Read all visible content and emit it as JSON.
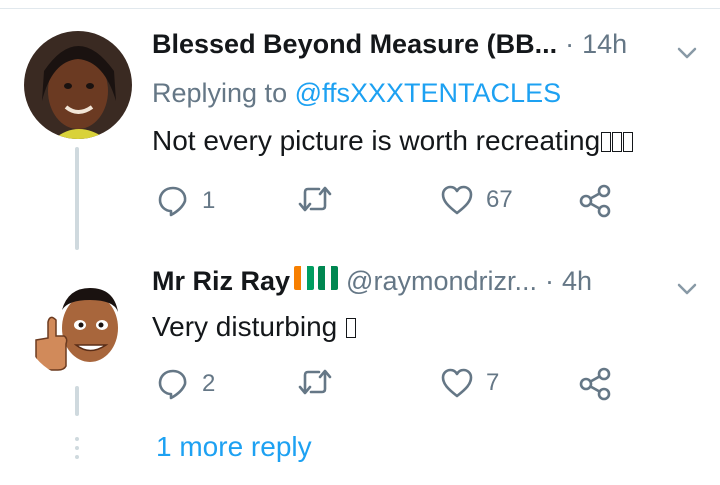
{
  "tweets": [
    {
      "name": "Blessed Beyond Measure (BB...",
      "handle": "",
      "time": "14h",
      "replying_prefix": "Replying to",
      "replying_to": "@ffsXXXTENTACLES",
      "text": "Not every picture is worth recreating",
      "emoji_count": 3,
      "actions": {
        "reply": "1",
        "retweet": "",
        "like": "67"
      }
    },
    {
      "name": "Mr Riz Ray",
      "handle": "@raymondrizr...",
      "time": "4h",
      "text": "Very disturbing",
      "emoji_count": 1,
      "flags": [
        "cote-divoire-flag",
        "nigeria-flag"
      ],
      "actions": {
        "reply": "2",
        "retweet": "",
        "like": "7"
      }
    }
  ],
  "more_replies": "1 more reply",
  "colors": {
    "link": "#1da1f2",
    "muted": "#657786",
    "text": "#14171a",
    "thread_line": "#cfd9de"
  }
}
